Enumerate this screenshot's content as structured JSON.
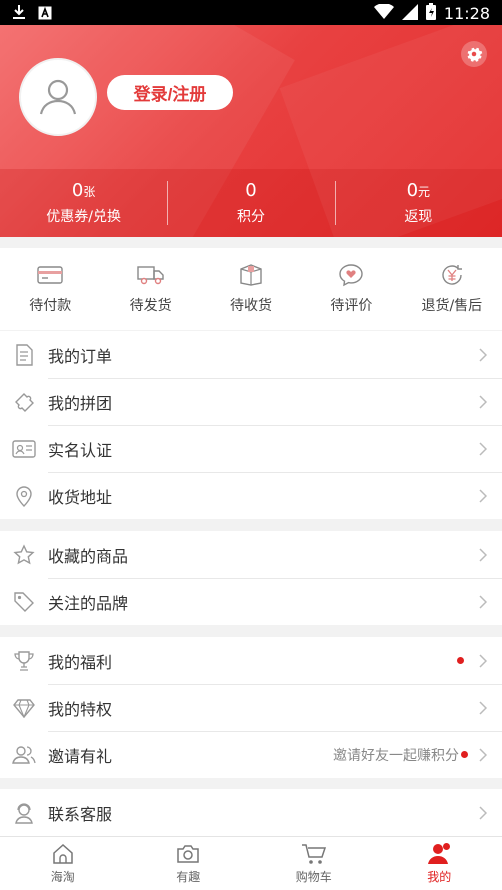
{
  "status_bar": {
    "time": "11:28"
  },
  "header": {
    "login_label": "登录/注册",
    "stats": [
      {
        "value": "0",
        "unit": "张",
        "label": "优惠券/兑换"
      },
      {
        "value": "0",
        "unit": "",
        "label": "积分"
      },
      {
        "value": "0",
        "unit": "元",
        "label": "返现"
      }
    ]
  },
  "orders": [
    {
      "label": "待付款",
      "icon": "card-icon"
    },
    {
      "label": "待发货",
      "icon": "truck-icon"
    },
    {
      "label": "待收货",
      "icon": "box-icon"
    },
    {
      "label": "待评价",
      "icon": "comment-heart-icon"
    },
    {
      "label": "退货/售后",
      "icon": "refund-icon"
    }
  ],
  "menu": {
    "group1": [
      {
        "label": "我的订单",
        "icon": "document-icon"
      },
      {
        "label": "我的拼团",
        "icon": "puzzle-icon"
      },
      {
        "label": "实名认证",
        "icon": "id-card-icon"
      },
      {
        "label": "收货地址",
        "icon": "location-icon"
      }
    ],
    "group2": [
      {
        "label": "收藏的商品",
        "icon": "star-icon"
      },
      {
        "label": "关注的品牌",
        "icon": "tag-icon"
      }
    ],
    "group3": [
      {
        "label": "我的福利",
        "icon": "trophy-icon",
        "extra": ""
      },
      {
        "label": "我的特权",
        "icon": "diamond-icon",
        "extra": ""
      },
      {
        "label": "邀请有礼",
        "icon": "users-icon",
        "extra": "邀请好友一起赚积分"
      }
    ],
    "group4": [
      {
        "label": "联系客服",
        "icon": "service-icon"
      }
    ]
  },
  "bottom_nav": [
    {
      "label": "海淘",
      "icon": "home-icon"
    },
    {
      "label": "有趣",
      "icon": "camera-icon"
    },
    {
      "label": "购物车",
      "icon": "cart-icon"
    },
    {
      "label": "我的",
      "icon": "user-icon"
    }
  ],
  "colors": {
    "accent": "#e01f1f"
  }
}
